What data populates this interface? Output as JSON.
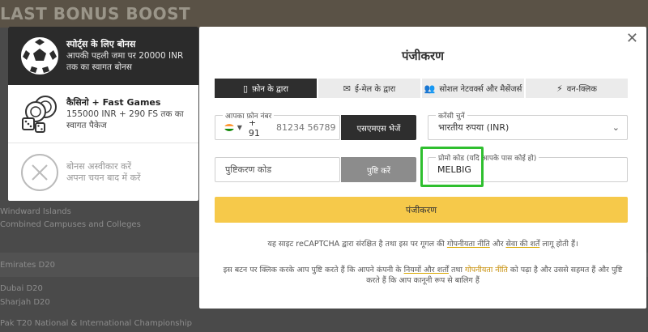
{
  "background": {
    "banner_title": "LAST BONUS BOOST",
    "rows": [
      "Windward Islands",
      "Combined Campuses and Colleges",
      "Emirates D20",
      "Dubai D20",
      "Sharjah D20",
      "Pak T20 National & International Championship"
    ]
  },
  "bonus_panel": {
    "sport": {
      "title": "स्पोर्ट्स के लिए बोनस",
      "desc_line1": "आपकी पहली जमा पर 20000 INR",
      "desc_line2": "तक का स्वागत बोनस",
      "icon": "soccer-ball-icon"
    },
    "casino": {
      "title": "कैसिनो + Fast Games",
      "desc_line1": "155000 INR + 290 FS तक का",
      "desc_line2": "स्वागत पैकेज",
      "icon": "casino-chips-icon"
    },
    "decline": {
      "line1": "बोनस अस्वीकार करें",
      "line2": "अपना चयन बाद में करें",
      "icon": "close-circle-icon"
    }
  },
  "modal": {
    "title": "पंजीकरण",
    "close": "✕",
    "tabs": [
      {
        "icon": "▯",
        "label": "फ़ोन के द्वारा",
        "active": true
      },
      {
        "icon": "✉",
        "label": "ई-मेल के द्वारा",
        "active": false
      },
      {
        "icon": "👥",
        "label": "सोशल नेटवर्क्स और मैसेंजर्स",
        "active": false
      },
      {
        "icon": "⚡",
        "label": "वन-क्लिक",
        "active": false
      }
    ],
    "phone": {
      "legend": "आपका फ़ोन नंबर",
      "code": "+ 91",
      "placeholder": "81234 56789",
      "country": "India"
    },
    "sms_button": "एसएमएस भेजें",
    "currency": {
      "legend": "करेंसी चुनें",
      "value": "भारतीय रुपया (INR)"
    },
    "confirm": {
      "placeholder": "पुष्टिकरण कोड",
      "button": "पुष्टि करें"
    },
    "promo": {
      "legend": "प्रोमो कोड (यदि आपके पास कोई हो)",
      "value": "MELBIG"
    },
    "register_button": "पंजीकरण",
    "recaptcha": {
      "pre": "यह साइट reCAPTCHA द्वारा संरक्षित है तथा इस पर गूगल की ",
      "privacy": "गोपनीयता नीति",
      "mid": " और ",
      "terms": "सेवा की शर्तें",
      "post": " लागू होती हैं।"
    },
    "consent": {
      "pre": "इस बटन पर क्लिक करके आप पुष्टि करते हैं कि आपने कंपनी के ",
      "terms": "नियमों और शर्तों",
      "mid": " तथा ",
      "privacy": "गोपनीयता नीति",
      "post1": " को पढ़ा है और उससे सहमत हैं और पुष्टि",
      "post2": "करते हैं कि आप कानूनी रूप से बालिग हैं"
    }
  },
  "colors": {
    "accent": "#f6c94a",
    "dark": "#2e2e2e",
    "highlight": "#2fbf2f",
    "link": "#c58b00"
  }
}
